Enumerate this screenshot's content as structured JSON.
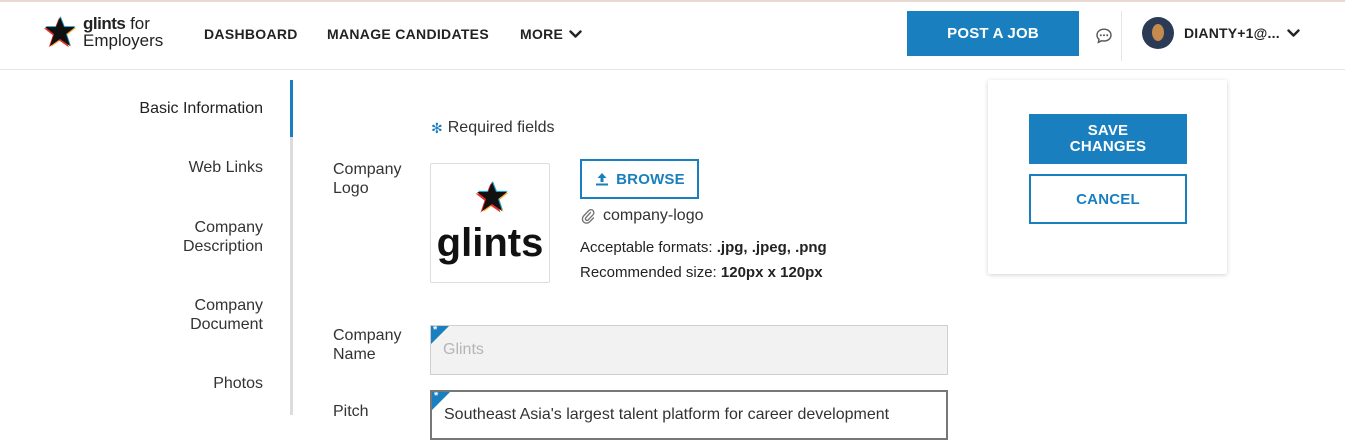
{
  "header": {
    "logo_brand": "glints",
    "logo_for": "for",
    "logo_sub": "Employers",
    "nav": {
      "dashboard": "DASHBOARD",
      "manage_candidates": "MANAGE CANDIDATES",
      "more": "MORE"
    },
    "post_job": "POST A JOB",
    "user_name": "DIANTY+1@...",
    "icons": [
      "glints-star-logo-icon",
      "chevron-down-icon",
      "chat-bubble-icon",
      "avatar",
      "chevron-down-icon"
    ]
  },
  "sidebar": {
    "items": [
      {
        "label": "Basic Information",
        "active": true
      },
      {
        "label": "Web Links"
      },
      {
        "label": "Company Description"
      },
      {
        "label": "Company Document"
      },
      {
        "label": "Photos"
      }
    ]
  },
  "form": {
    "required_note": "Required fields",
    "logo_label": "Company Logo",
    "logo_wordmark": "glints",
    "browse_label": "BROWSE",
    "file_name": "company-logo",
    "formats_prefix": "Acceptable formats: ",
    "formats_value": ".jpg, .jpeg, .png",
    "size_prefix": "Recommended size: ",
    "size_value": "120px x 120px",
    "name_label": "Company Name",
    "name_placeholder": "Glints",
    "pitch_label": "Pitch",
    "pitch_value": "Southeast Asia's largest talent platform for career development"
  },
  "actions": {
    "save_label": "SAVE CHANGES",
    "cancel_label": "CANCEL"
  },
  "colors": {
    "accent": "#1a7fbf",
    "text": "#222222"
  }
}
